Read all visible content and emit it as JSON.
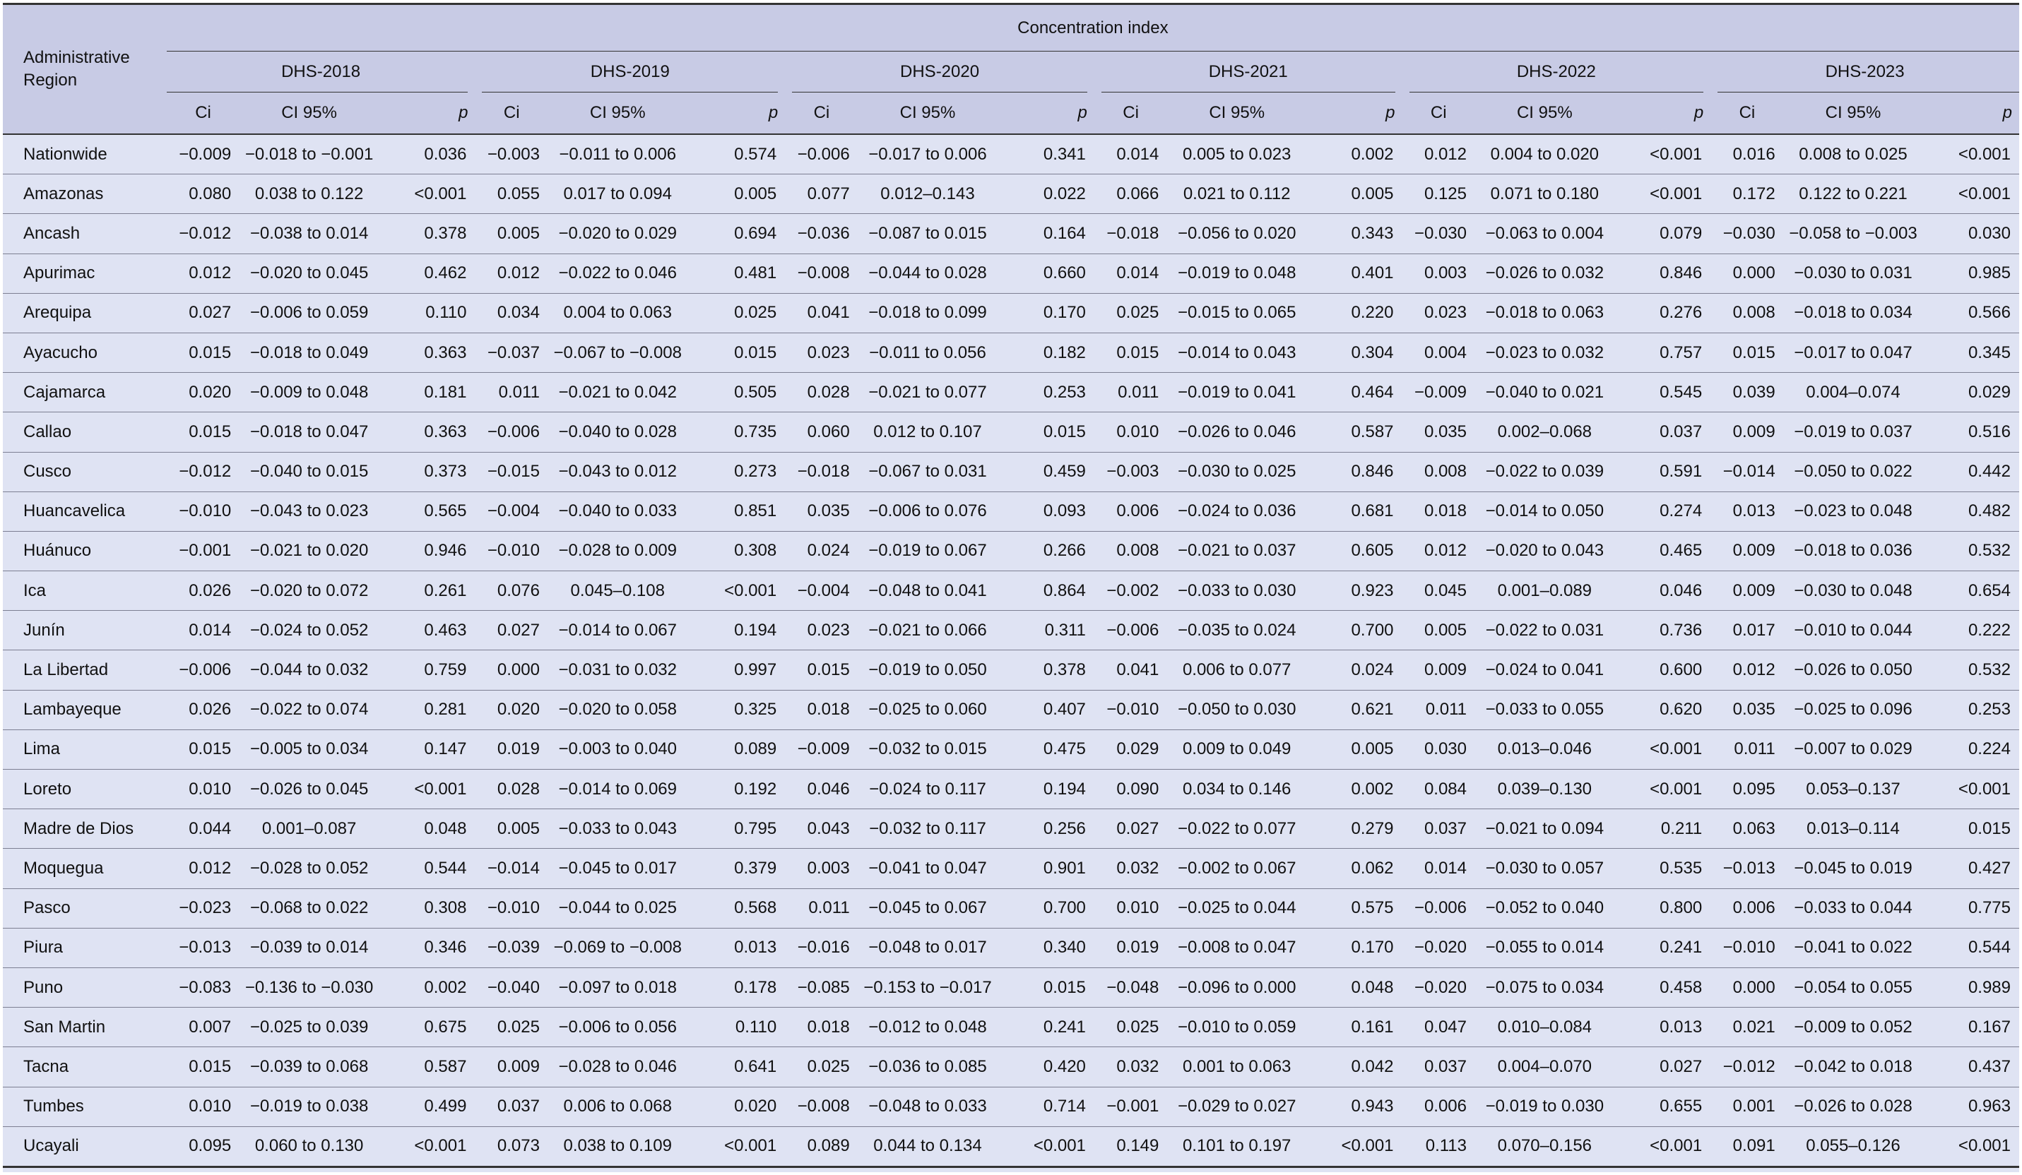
{
  "header": {
    "region_label": "Administrative Region",
    "super_header": "Concentration index",
    "surveys": [
      "DHS-2018",
      "DHS-2019",
      "DHS-2020",
      "DHS-2021",
      "DHS-2022",
      "DHS-2023"
    ],
    "sub_headers": {
      "ci": "Ci",
      "ci95": "CI 95%",
      "p": "p"
    }
  },
  "rows": [
    [
      "Nationwide",
      "−0.009",
      "−0.018 to −0.001",
      "0.036",
      "−0.003",
      "−0.011 to 0.006",
      "0.574",
      "−0.006",
      "−0.017 to 0.006",
      "0.341",
      "0.014",
      "0.005 to 0.023",
      "0.002",
      "0.012",
      "0.004 to 0.020",
      "<0.001",
      "0.016",
      "0.008 to 0.025",
      "<0.001"
    ],
    [
      "Amazonas",
      "0.080",
      "0.038 to 0.122",
      "<0.001",
      "0.055",
      "0.017 to 0.094",
      "0.005",
      "0.077",
      "0.012–0.143",
      "0.022",
      "0.066",
      "0.021 to 0.112",
      "0.005",
      "0.125",
      "0.071 to 0.180",
      "<0.001",
      "0.172",
      "0.122 to 0.221",
      "<0.001"
    ],
    [
      "Ancash",
      "−0.012",
      "−0.038 to 0.014",
      "0.378",
      "0.005",
      "−0.020 to 0.029",
      "0.694",
      "−0.036",
      "−0.087 to 0.015",
      "0.164",
      "−0.018",
      "−0.056 to 0.020",
      "0.343",
      "−0.030",
      "−0.063 to 0.004",
      "0.079",
      "−0.030",
      "−0.058 to −0.003",
      "0.030"
    ],
    [
      "Apurimac",
      "0.012",
      "−0.020 to 0.045",
      "0.462",
      "0.012",
      "−0.022 to 0.046",
      "0.481",
      "−0.008",
      "−0.044 to 0.028",
      "0.660",
      "0.014",
      "−0.019 to 0.048",
      "0.401",
      "0.003",
      "−0.026 to 0.032",
      "0.846",
      "0.000",
      "−0.030 to 0.031",
      "0.985"
    ],
    [
      "Arequipa",
      "0.027",
      "−0.006 to 0.059",
      "0.110",
      "0.034",
      "0.004 to 0.063",
      "0.025",
      "0.041",
      "−0.018 to 0.099",
      "0.170",
      "0.025",
      "−0.015 to 0.065",
      "0.220",
      "0.023",
      "−0.018 to 0.063",
      "0.276",
      "0.008",
      "−0.018 to 0.034",
      "0.566"
    ],
    [
      "Ayacucho",
      "0.015",
      "−0.018 to 0.049",
      "0.363",
      "−0.037",
      "−0.067 to −0.008",
      "0.015",
      "0.023",
      "−0.011 to 0.056",
      "0.182",
      "0.015",
      "−0.014 to 0.043",
      "0.304",
      "0.004",
      "−0.023 to 0.032",
      "0.757",
      "0.015",
      "−0.017 to 0.047",
      "0.345"
    ],
    [
      "Cajamarca",
      "0.020",
      "−0.009 to 0.048",
      "0.181",
      "0.011",
      "−0.021 to 0.042",
      "0.505",
      "0.028",
      "−0.021 to 0.077",
      "0.253",
      "0.011",
      "−0.019 to 0.041",
      "0.464",
      "−0.009",
      "−0.040 to 0.021",
      "0.545",
      "0.039",
      "0.004–0.074",
      "0.029"
    ],
    [
      "Callao",
      "0.015",
      "−0.018 to 0.047",
      "0.363",
      "−0.006",
      "−0.040 to 0.028",
      "0.735",
      "0.060",
      "0.012 to 0.107",
      "0.015",
      "0.010",
      "−0.026 to 0.046",
      "0.587",
      "0.035",
      "0.002–0.068",
      "0.037",
      "0.009",
      "−0.019 to 0.037",
      "0.516"
    ],
    [
      "Cusco",
      "−0.012",
      "−0.040 to 0.015",
      "0.373",
      "−0.015",
      "−0.043 to 0.012",
      "0.273",
      "−0.018",
      "−0.067 to 0.031",
      "0.459",
      "−0.003",
      "−0.030 to 0.025",
      "0.846",
      "0.008",
      "−0.022 to 0.039",
      "0.591",
      "−0.014",
      "−0.050 to 0.022",
      "0.442"
    ],
    [
      "Huancavelica",
      "−0.010",
      "−0.043 to 0.023",
      "0.565",
      "−0.004",
      "−0.040 to 0.033",
      "0.851",
      "0.035",
      "−0.006 to 0.076",
      "0.093",
      "0.006",
      "−0.024 to 0.036",
      "0.681",
      "0.018",
      "−0.014 to 0.050",
      "0.274",
      "0.013",
      "−0.023 to 0.048",
      "0.482"
    ],
    [
      "Huánuco",
      "−0.001",
      "−0.021 to 0.020",
      "0.946",
      "−0.010",
      "−0.028 to 0.009",
      "0.308",
      "0.024",
      "−0.019 to 0.067",
      "0.266",
      "0.008",
      "−0.021 to 0.037",
      "0.605",
      "0.012",
      "−0.020 to 0.043",
      "0.465",
      "0.009",
      "−0.018 to 0.036",
      "0.532"
    ],
    [
      "Ica",
      "0.026",
      "−0.020 to 0.072",
      "0.261",
      "0.076",
      "0.045–0.108",
      "<0.001",
      "−0.004",
      "−0.048 to 0.041",
      "0.864",
      "−0.002",
      "−0.033 to 0.030",
      "0.923",
      "0.045",
      "0.001–0.089",
      "0.046",
      "0.009",
      "−0.030 to 0.048",
      "0.654"
    ],
    [
      "Junín",
      "0.014",
      "−0.024 to 0.052",
      "0.463",
      "0.027",
      "−0.014 to 0.067",
      "0.194",
      "0.023",
      "−0.021 to 0.066",
      "0.311",
      "−0.006",
      "−0.035 to 0.024",
      "0.700",
      "0.005",
      "−0.022 to 0.031",
      "0.736",
      "0.017",
      "−0.010 to 0.044",
      "0.222"
    ],
    [
      "La Libertad",
      "−0.006",
      "−0.044 to 0.032",
      "0.759",
      "0.000",
      "−0.031 to 0.032",
      "0.997",
      "0.015",
      "−0.019 to 0.050",
      "0.378",
      "0.041",
      "0.006 to 0.077",
      "0.024",
      "0.009",
      "−0.024 to 0.041",
      "0.600",
      "0.012",
      "−0.026 to 0.050",
      "0.532"
    ],
    [
      "Lambayeque",
      "0.026",
      "−0.022 to 0.074",
      "0.281",
      "0.020",
      "−0.020 to 0.058",
      "0.325",
      "0.018",
      "−0.025 to 0.060",
      "0.407",
      "−0.010",
      "−0.050 to 0.030",
      "0.621",
      "0.011",
      "−0.033 to 0.055",
      "0.620",
      "0.035",
      "−0.025 to 0.096",
      "0.253"
    ],
    [
      "Lima",
      "0.015",
      "−0.005 to 0.034",
      "0.147",
      "0.019",
      "−0.003 to 0.040",
      "0.089",
      "−0.009",
      "−0.032 to 0.015",
      "0.475",
      "0.029",
      "0.009 to 0.049",
      "0.005",
      "0.030",
      "0.013–0.046",
      "<0.001",
      "0.011",
      "−0.007 to 0.029",
      "0.224"
    ],
    [
      "Loreto",
      "0.010",
      "−0.026 to 0.045",
      "<0.001",
      "0.028",
      "−0.014 to 0.069",
      "0.192",
      "0.046",
      "−0.024 to 0.117",
      "0.194",
      "0.090",
      "0.034 to 0.146",
      "0.002",
      "0.084",
      "0.039–0.130",
      "<0.001",
      "0.095",
      "0.053–0.137",
      "<0.001"
    ],
    [
      "Madre de Dios",
      "0.044",
      "0.001–0.087",
      "0.048",
      "0.005",
      "−0.033 to 0.043",
      "0.795",
      "0.043",
      "−0.032 to 0.117",
      "0.256",
      "0.027",
      "−0.022 to 0.077",
      "0.279",
      "0.037",
      "−0.021 to 0.094",
      "0.211",
      "0.063",
      "0.013–0.114",
      "0.015"
    ],
    [
      "Moquegua",
      "0.012",
      "−0.028 to 0.052",
      "0.544",
      "−0.014",
      "−0.045 to 0.017",
      "0.379",
      "0.003",
      "−0.041 to 0.047",
      "0.901",
      "0.032",
      "−0.002 to 0.067",
      "0.062",
      "0.014",
      "−0.030 to 0.057",
      "0.535",
      "−0.013",
      "−0.045 to 0.019",
      "0.427"
    ],
    [
      "Pasco",
      "−0.023",
      "−0.068 to 0.022",
      "0.308",
      "−0.010",
      "−0.044 to 0.025",
      "0.568",
      "0.011",
      "−0.045 to 0.067",
      "0.700",
      "0.010",
      "−0.025 to 0.044",
      "0.575",
      "−0.006",
      "−0.052 to 0.040",
      "0.800",
      "0.006",
      "−0.033 to 0.044",
      "0.775"
    ],
    [
      "Piura",
      "−0.013",
      "−0.039 to 0.014",
      "0.346",
      "−0.039",
      "−0.069 to −0.008",
      "0.013",
      "−0.016",
      "−0.048 to 0.017",
      "0.340",
      "0.019",
      "−0.008 to 0.047",
      "0.170",
      "−0.020",
      "−0.055 to 0.014",
      "0.241",
      "−0.010",
      "−0.041 to 0.022",
      "0.544"
    ],
    [
      "Puno",
      "−0.083",
      "−0.136 to −0.030",
      "0.002",
      "−0.040",
      "−0.097 to 0.018",
      "0.178",
      "−0.085",
      "−0.153 to −0.017",
      "0.015",
      "−0.048",
      "−0.096 to 0.000",
      "0.048",
      "−0.020",
      "−0.075 to 0.034",
      "0.458",
      "0.000",
      "−0.054 to 0.055",
      "0.989"
    ],
    [
      "San Martin",
      "0.007",
      "−0.025 to 0.039",
      "0.675",
      "0.025",
      "−0.006 to 0.056",
      "0.110",
      "0.018",
      "−0.012 to 0.048",
      "0.241",
      "0.025",
      "−0.010 to 0.059",
      "0.161",
      "0.047",
      "0.010–0.084",
      "0.013",
      "0.021",
      "−0.009 to 0.052",
      "0.167"
    ],
    [
      "Tacna",
      "0.015",
      "−0.039 to 0.068",
      "0.587",
      "0.009",
      "−0.028 to 0.046",
      "0.641",
      "0.025",
      "−0.036 to 0.085",
      "0.420",
      "0.032",
      "0.001 to 0.063",
      "0.042",
      "0.037",
      "0.004–0.070",
      "0.027",
      "−0.012",
      "−0.042 to 0.018",
      "0.437"
    ],
    [
      "Tumbes",
      "0.010",
      "−0.019 to 0.038",
      "0.499",
      "0.037",
      "0.006 to 0.068",
      "0.020",
      "−0.008",
      "−0.048 to 0.033",
      "0.714",
      "−0.001",
      "−0.029 to 0.027",
      "0.943",
      "0.006",
      "−0.019 to 0.030",
      "0.655",
      "0.001",
      "−0.026 to 0.028",
      "0.963"
    ],
    [
      "Ucayali",
      "0.095",
      "0.060 to 0.130",
      "<0.001",
      "0.073",
      "0.038 to 0.109",
      "<0.001",
      "0.089",
      "0.044 to 0.134",
      "<0.001",
      "0.149",
      "0.101 to 0.197",
      "<0.001",
      "0.113",
      "0.070–0.156",
      "<0.001",
      "0.091",
      "0.055–0.126",
      "<0.001"
    ]
  ]
}
